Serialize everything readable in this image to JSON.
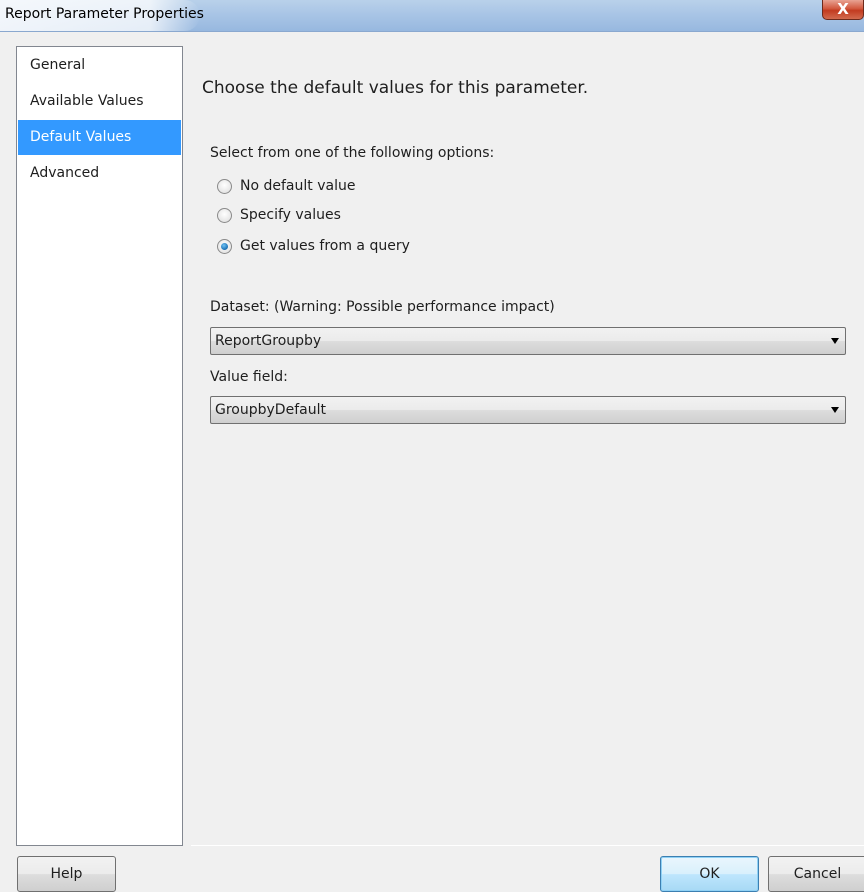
{
  "window": {
    "title": "Report Parameter Properties",
    "close_glyph": "X"
  },
  "nav": {
    "items": [
      {
        "label": "General",
        "selected": false
      },
      {
        "label": "Available Values",
        "selected": false
      },
      {
        "label": "Default Values",
        "selected": true
      },
      {
        "label": "Advanced",
        "selected": false
      }
    ]
  },
  "main": {
    "heading": "Choose the default values for this parameter.",
    "options_label": "Select from one of the following options:",
    "options": [
      {
        "label": "No default value",
        "checked": false
      },
      {
        "label": "Specify values",
        "checked": false
      },
      {
        "label": "Get values from a query",
        "checked": true
      }
    ],
    "dataset_label": "Dataset: (Warning: Possible performance impact)",
    "dataset_value": "ReportGroupby",
    "value_field_label": "Value field:",
    "value_field_value": "GroupbyDefault"
  },
  "footer": {
    "help_label": "Help",
    "ok_label": "OK",
    "cancel_label": "Cancel"
  },
  "colors": {
    "selection": "#3399ff",
    "titlebar": "#a9c5e6",
    "close_button": "#c23b20",
    "radio_checked": "#1a6fb3"
  },
  "icons": {
    "close": "close-icon",
    "dropdown": "chevron-down-icon"
  }
}
